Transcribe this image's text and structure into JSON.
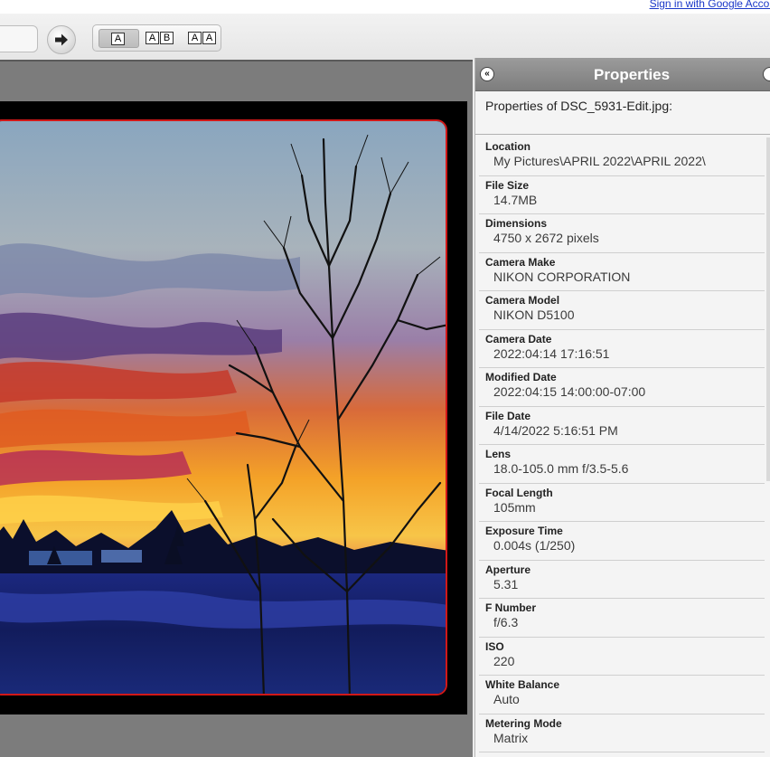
{
  "header": {
    "signin_link": "Sign in with Google Accou"
  },
  "toolbar": {
    "view_modes": [
      {
        "boxes": [
          "A"
        ]
      },
      {
        "boxes": [
          "A",
          "B"
        ]
      },
      {
        "boxes": [
          "A",
          "A"
        ]
      }
    ],
    "selected_view_mode": "A"
  },
  "panel": {
    "title": "Properties",
    "subtitle": "Properties of DSC_5931-Edit.jpg:",
    "properties": [
      {
        "label": "Location",
        "value": "My Pictures\\APRIL 2022\\APRIL 2022\\"
      },
      {
        "label": "File Size",
        "value": "14.7MB"
      },
      {
        "label": "Dimensions",
        "value": "4750 x 2672 pixels"
      },
      {
        "label": "Camera Make",
        "value": "NIKON CORPORATION"
      },
      {
        "label": "Camera Model",
        "value": "NIKON D5100"
      },
      {
        "label": "Camera Date",
        "value": "2022:04:14 17:16:51"
      },
      {
        "label": "Modified Date",
        "value": "2022:04:15 14:00:00-07:00"
      },
      {
        "label": "File Date",
        "value": "4/14/2022 5:16:51 PM"
      },
      {
        "label": "Lens",
        "value": "18.0-105.0 mm f/3.5-5.6"
      },
      {
        "label": "Focal Length",
        "value": "105mm"
      },
      {
        "label": "Exposure Time",
        "value": "0.004s (1/250)"
      },
      {
        "label": "Aperture",
        "value": "5.31"
      },
      {
        "label": "F Number",
        "value": "f/6.3"
      },
      {
        "label": "ISO",
        "value": "220"
      },
      {
        "label": "White Balance",
        "value": "Auto"
      },
      {
        "label": "Metering Mode",
        "value": "Matrix"
      }
    ]
  },
  "icons": {
    "next": "arrow-right-icon",
    "collapse": "double-chevron-left-icon",
    "close": "close-icon"
  },
  "colors": {
    "photo_border": "#d11818",
    "panel_header": "#8a8a8a",
    "link": "#1a38c8"
  }
}
